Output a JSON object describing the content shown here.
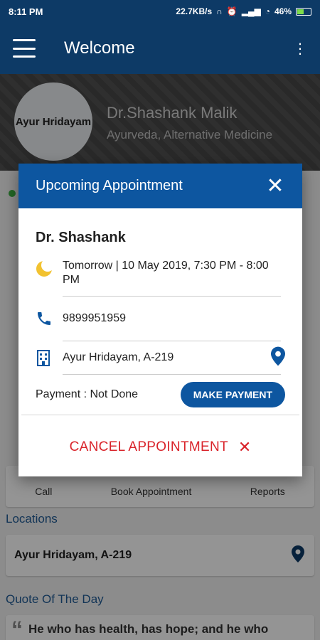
{
  "status_bar": {
    "time": "8:11 PM",
    "speed": "22.7KB/s",
    "battery": "46%"
  },
  "app_bar": {
    "title": "Welcome"
  },
  "profile": {
    "clinic_name": "Ayur Hridayam",
    "doctor_name": "Dr.Shashank Malik",
    "specialty": "Ayurveda, Alternative Medicine"
  },
  "background": {
    "quick_actions": [
      "Call",
      "Book Appointment",
      "Reports"
    ],
    "locations_label": "Locations",
    "location_name": "Ayur Hridayam, A-219",
    "quote_label": "Quote Of The Day",
    "quote_text": "He who has health, has hope; and he who"
  },
  "dialog": {
    "title": "Upcoming Appointment",
    "doctor": "Dr. Shashank",
    "time": "Tomorrow | 10 May 2019, 7:30 PM - 8:00 PM",
    "phone": "9899951959",
    "location": "Ayur Hridayam, A-219",
    "payment_status": "Payment : Not Done",
    "make_payment_label": "MAKE PAYMENT",
    "cancel_label": "CANCEL APPOINTMENT"
  },
  "colors": {
    "primary_dark": "#0d3a66",
    "primary": "#0d56a0",
    "cancel_red": "#d9232a",
    "online_green": "#3cb043",
    "moon_yellow": "#f2c230"
  }
}
